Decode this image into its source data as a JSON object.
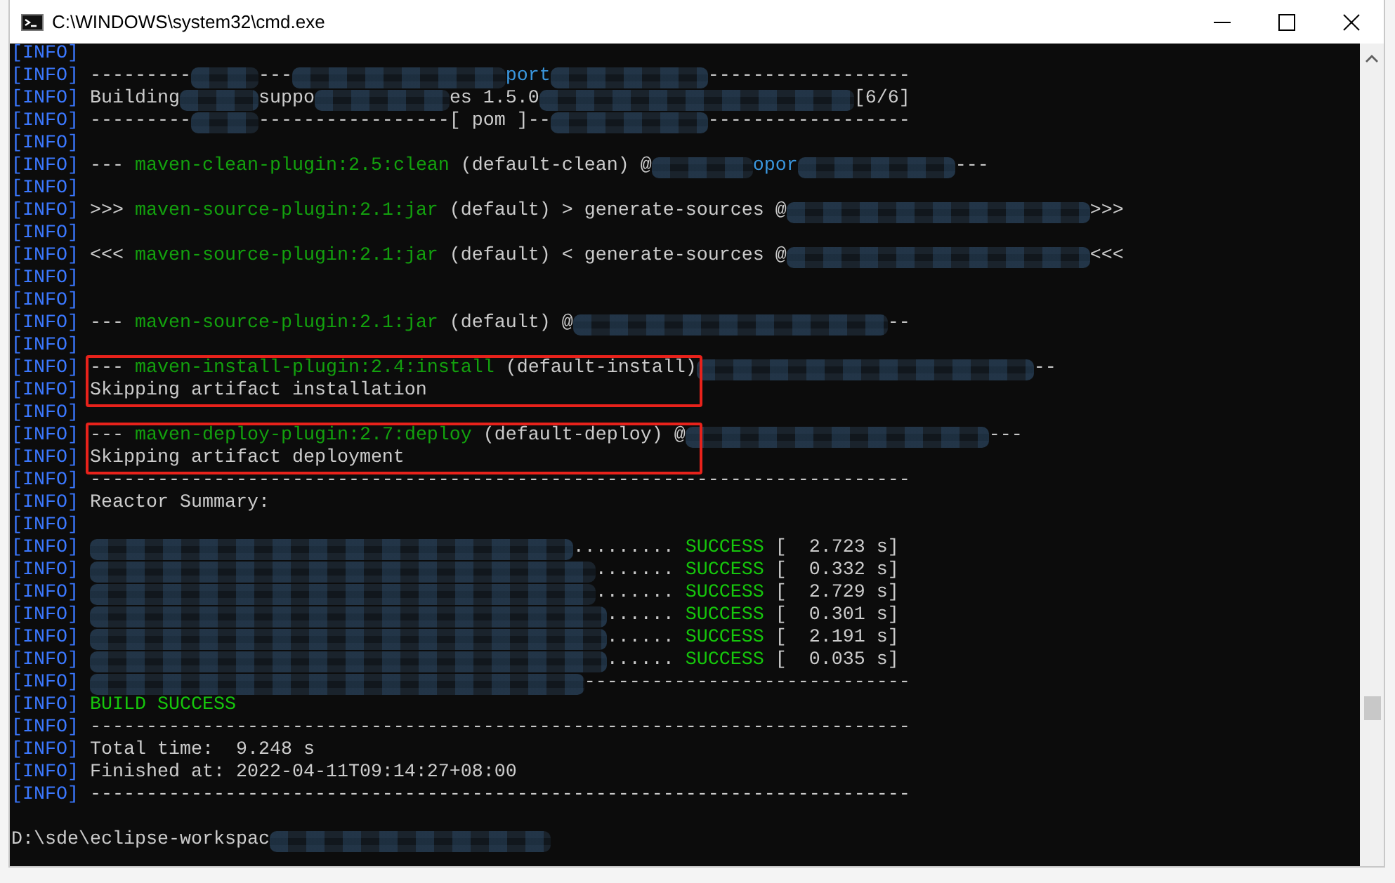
{
  "window": {
    "title": "C:\\WINDOWS\\system32\\cmd.exe"
  },
  "console": {
    "lines": [
      {
        "tag": "[INFO]",
        "highlighted": false
      },
      {
        "tag": "[INFO]",
        "highlighted": false,
        "segments": [
          {
            "kind": "plain",
            "text": "---------"
          },
          {
            "kind": "redacted"
          },
          {
            "kind": "plain",
            "text": "---"
          },
          {
            "kind": "redacted"
          },
          {
            "kind": "module",
            "text": "port"
          },
          {
            "kind": "redacted"
          },
          {
            "kind": "plain",
            "text": "------------------"
          }
        ]
      },
      {
        "tag": "[INFO]",
        "highlighted": false,
        "segments": [
          {
            "kind": "plain",
            "text": "Building"
          },
          {
            "kind": "redacted"
          },
          {
            "kind": "plain",
            "text": "suppo"
          },
          {
            "kind": "redacted"
          },
          {
            "kind": "plain",
            "text": "es 1.5.0"
          },
          {
            "kind": "redacted"
          },
          {
            "kind": "plain",
            "text": "[6/6]"
          }
        ]
      },
      {
        "tag": "[INFO]",
        "highlighted": false,
        "segments": [
          {
            "kind": "plain",
            "text": "---------"
          },
          {
            "kind": "redacted"
          },
          {
            "kind": "plain",
            "text": "-----------------[ pom ]--"
          },
          {
            "kind": "redacted"
          },
          {
            "kind": "plain",
            "text": "------------------"
          }
        ]
      },
      {
        "tag": "[INFO]",
        "highlighted": false
      },
      {
        "tag": "[INFO]",
        "highlighted": false,
        "segments": [
          {
            "kind": "plain",
            "text": "--- "
          },
          {
            "kind": "plugin",
            "text": "maven-clean-plugin:2.5:clean"
          },
          {
            "kind": "plain",
            "text": " (default-clean) @"
          },
          {
            "kind": "redacted"
          },
          {
            "kind": "module",
            "text": "opor"
          },
          {
            "kind": "redacted"
          },
          {
            "kind": "plain",
            "text": "---"
          }
        ]
      },
      {
        "tag": "[INFO]",
        "highlighted": false
      },
      {
        "tag": "[INFO]",
        "highlighted": false,
        "segments": [
          {
            "kind": "plain",
            "text": ">>> "
          },
          {
            "kind": "plugin",
            "text": "maven-source-plugin:2.1:jar"
          },
          {
            "kind": "plain",
            "text": " (default) > generate-sources @"
          },
          {
            "kind": "redacted"
          },
          {
            "kind": "plain",
            "text": ">>>"
          }
        ]
      },
      {
        "tag": "[INFO]",
        "highlighted": false
      },
      {
        "tag": "[INFO]",
        "highlighted": false,
        "segments": [
          {
            "kind": "plain",
            "text": "<<< "
          },
          {
            "kind": "plugin",
            "text": "maven-source-plugin:2.1:jar"
          },
          {
            "kind": "plain",
            "text": " (default) < generate-sources @"
          },
          {
            "kind": "redacted"
          },
          {
            "kind": "plain",
            "text": "<<<"
          }
        ]
      },
      {
        "tag": "[INFO]",
        "highlighted": false
      },
      {
        "tag": "[INFO]",
        "highlighted": false
      },
      {
        "tag": "[INFO]",
        "highlighted": false,
        "segments": [
          {
            "kind": "plain",
            "text": "--- "
          },
          {
            "kind": "plugin",
            "text": "maven-source-plugin:2.1:jar"
          },
          {
            "kind": "plain",
            "text": " (default) @"
          },
          {
            "kind": "redacted"
          },
          {
            "kind": "plain",
            "text": "--"
          }
        ]
      },
      {
        "tag": "[INFO]",
        "highlighted": false
      },
      {
        "tag": "[INFO]",
        "highlighted": true,
        "segments": [
          {
            "kind": "plain",
            "text": "--- "
          },
          {
            "kind": "plugin",
            "text": "maven-install-plugin:2.4:install"
          },
          {
            "kind": "plain",
            "text": " (default-install)"
          },
          {
            "kind": "redacted"
          },
          {
            "kind": "plain",
            "text": "--"
          }
        ]
      },
      {
        "tag": "[INFO]",
        "highlighted": true,
        "segments": [
          {
            "kind": "plain",
            "text": "Skipping artifact installation"
          }
        ]
      },
      {
        "tag": "[INFO]",
        "highlighted": false
      },
      {
        "tag": "[INFO]",
        "highlighted": true,
        "segments": [
          {
            "kind": "plain",
            "text": "--- "
          },
          {
            "kind": "plugin",
            "text": "maven-deploy-plugin:2.7:deploy"
          },
          {
            "kind": "plain",
            "text": " (default-deploy) @"
          },
          {
            "kind": "redacted"
          },
          {
            "kind": "plain",
            "text": "---"
          }
        ]
      },
      {
        "tag": "[INFO]",
        "highlighted": true,
        "segments": [
          {
            "kind": "plain",
            "text": "Skipping artifact deployment"
          }
        ]
      },
      {
        "tag": "[INFO]",
        "highlighted": false,
        "segments": [
          {
            "kind": "plain",
            "text": "-------------------------------------------------------------------------"
          }
        ]
      },
      {
        "tag": "[INFO]",
        "highlighted": false,
        "segments": [
          {
            "kind": "plain",
            "text": "Reactor Summary:"
          }
        ]
      },
      {
        "tag": "[INFO]",
        "highlighted": false
      },
      {
        "tag": "[INFO]",
        "highlighted": false,
        "segments": [
          {
            "kind": "redacted"
          },
          {
            "kind": "plain",
            "text": "......... "
          },
          {
            "kind": "success",
            "text": "SUCCESS"
          },
          {
            "kind": "plain",
            "text": " [  2.723 s]"
          }
        ]
      },
      {
        "tag": "[INFO]",
        "highlighted": false,
        "segments": [
          {
            "kind": "redacted"
          },
          {
            "kind": "plain",
            "text": "....... "
          },
          {
            "kind": "success",
            "text": "SUCCESS"
          },
          {
            "kind": "plain",
            "text": " [  0.332 s]"
          }
        ]
      },
      {
        "tag": "[INFO]",
        "highlighted": false,
        "segments": [
          {
            "kind": "redacted"
          },
          {
            "kind": "plain",
            "text": "....... "
          },
          {
            "kind": "success",
            "text": "SUCCESS"
          },
          {
            "kind": "plain",
            "text": " [  2.729 s]"
          }
        ]
      },
      {
        "tag": "[INFO]",
        "highlighted": false,
        "segments": [
          {
            "kind": "redacted"
          },
          {
            "kind": "plain",
            "text": "...... "
          },
          {
            "kind": "success",
            "text": "SUCCESS"
          },
          {
            "kind": "plain",
            "text": " [  0.301 s]"
          }
        ]
      },
      {
        "tag": "[INFO]",
        "highlighted": false,
        "segments": [
          {
            "kind": "redacted"
          },
          {
            "kind": "plain",
            "text": "...... "
          },
          {
            "kind": "success",
            "text": "SUCCESS"
          },
          {
            "kind": "plain",
            "text": " [  2.191 s]"
          }
        ]
      },
      {
        "tag": "[INFO]",
        "highlighted": false,
        "segments": [
          {
            "kind": "redacted"
          },
          {
            "kind": "plain",
            "text": "...... "
          },
          {
            "kind": "success",
            "text": "SUCCESS"
          },
          {
            "kind": "plain",
            "text": " [  0.035 s]"
          }
        ]
      },
      {
        "tag": "[INFO]",
        "highlighted": false,
        "segments": [
          {
            "kind": "redacted"
          },
          {
            "kind": "plain",
            "text": "-----------------------------"
          }
        ]
      },
      {
        "tag": "[INFO]",
        "highlighted": false,
        "segments": [
          {
            "kind": "success",
            "text": "BUILD SUCCESS"
          }
        ]
      },
      {
        "tag": "[INFO]",
        "highlighted": false,
        "segments": [
          {
            "kind": "plain",
            "text": "-------------------------------------------------------------------------"
          }
        ]
      },
      {
        "tag": "[INFO]",
        "highlighted": false,
        "segments": [
          {
            "kind": "plain",
            "text": "Total time:  9.248 s"
          }
        ]
      },
      {
        "tag": "[INFO]",
        "highlighted": false,
        "segments": [
          {
            "kind": "plain",
            "text": "Finished at: 2022-04-11T09:14:27+08:00"
          }
        ]
      },
      {
        "tag": "[INFO]",
        "highlighted": false,
        "segments": [
          {
            "kind": "plain",
            "text": "-------------------------------------------------------------------------"
          }
        ]
      },
      {
        "highlighted": false
      },
      {
        "highlighted": false,
        "segments": [
          {
            "kind": "plain",
            "text": "D:\\sde\\eclipse-workspac"
          },
          {
            "kind": "redacted"
          }
        ]
      }
    ]
  }
}
